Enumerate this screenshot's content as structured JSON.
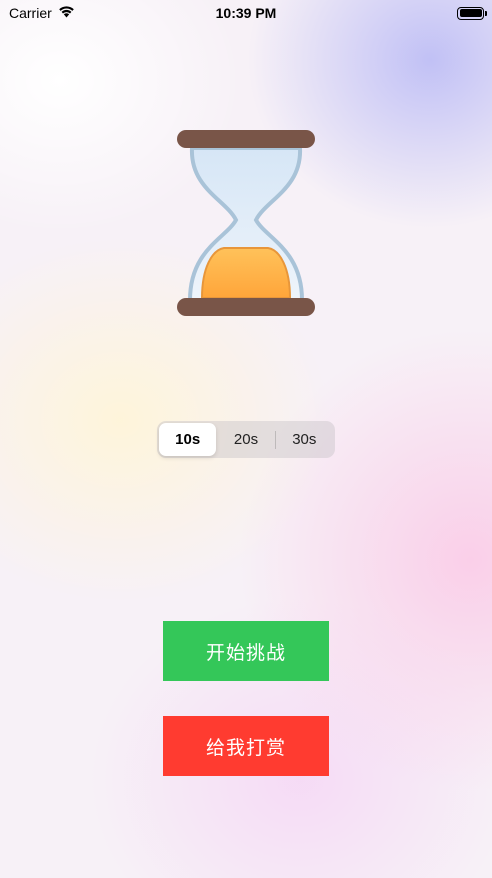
{
  "status_bar": {
    "carrier": "Carrier",
    "time": "10:39 PM"
  },
  "timer": {
    "icon": "hourglass-icon",
    "segments": [
      {
        "label": "10s",
        "selected": true
      },
      {
        "label": "20s",
        "selected": false
      },
      {
        "label": "30s",
        "selected": false
      }
    ]
  },
  "buttons": {
    "start_label": "开始挑战",
    "start_color": "#34C759",
    "reward_label": "给我打赏",
    "reward_color": "#FF3B30"
  }
}
